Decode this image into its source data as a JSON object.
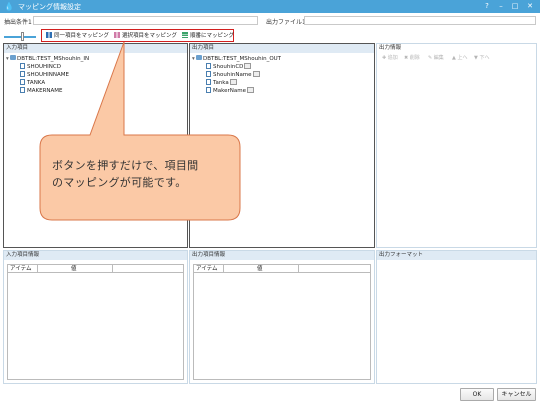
{
  "window": {
    "title": "マッピング情報設定",
    "help_glyph": "?",
    "minimize_glyph": "–",
    "maximize_glyph": "□",
    "close_glyph": "✕",
    "accent": "#4aa3d8"
  },
  "filters": {
    "extract_condition_label": "抽出条件1",
    "extract_condition_value": "",
    "output_file_label": "出力ファイル1",
    "output_file_value": ""
  },
  "mapping_toolbar": {
    "same_item_label": "同一項目をマッピング",
    "selected_item_label": "選択項目をマッピング",
    "sequential_label": "順番にマッピング",
    "highlight_color": "#d21f1f"
  },
  "input_panel": {
    "title": "入力項目",
    "root": "DBTBL:TEST_MShouhin_IN",
    "fields": [
      "SHOUHINCD",
      "SHOUHINNAME",
      "TANKA",
      "MAKERNAME"
    ]
  },
  "output_panel": {
    "title": "出力項目",
    "root": "DBTBL:TEST_MShouhin_OUT",
    "fields": [
      "ShouhinCD",
      "ShouhinName",
      "Tanka",
      "MakerName"
    ]
  },
  "output_info": {
    "title": "出力情報",
    "buttons": [
      "追加",
      "削除",
      "編集",
      "上へ",
      "下へ"
    ]
  },
  "input_item_info": {
    "title": "入力項目情報",
    "col_item": "アイテム",
    "col_value": "値"
  },
  "output_item_info": {
    "title": "出力項目情報",
    "col_item": "アイテム",
    "col_value": "値"
  },
  "output_format": {
    "title": "出力フォーマット"
  },
  "callout": {
    "line1": "ボタンを押すだけで、項目間",
    "line2": "のマッピングが可能です。",
    "fill": "#fbc9a6",
    "stroke": "#d9774a"
  },
  "dialog": {
    "ok_label": "OK",
    "cancel_label": "キャンセル"
  }
}
